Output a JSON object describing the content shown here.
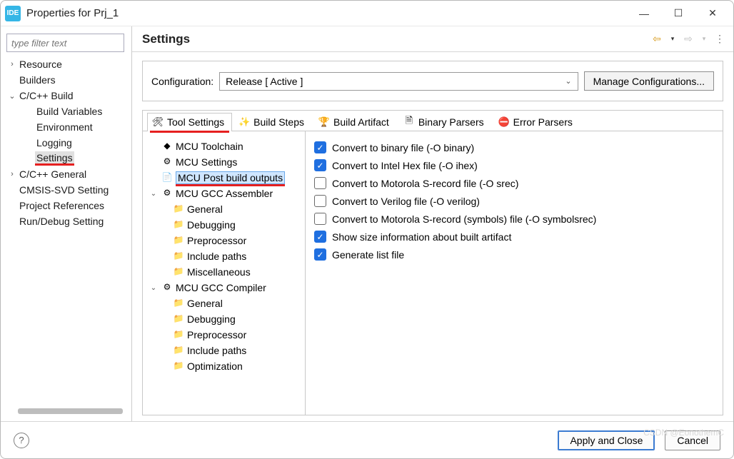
{
  "window": {
    "app_badge": "IDE",
    "title": "Properties for Prj_1"
  },
  "nav": {
    "filter_placeholder": "type filter text",
    "items": [
      {
        "label": "Resource",
        "expandable": true,
        "expanded": false
      },
      {
        "label": "Builders"
      },
      {
        "label": "C/C++ Build",
        "expandable": true,
        "expanded": true,
        "children": [
          {
            "label": "Build Variables"
          },
          {
            "label": "Environment"
          },
          {
            "label": "Logging"
          },
          {
            "label": "Settings",
            "highlighted": true
          }
        ]
      },
      {
        "label": "C/C++ General",
        "expandable": true,
        "expanded": false
      },
      {
        "label": "CMSIS-SVD Setting"
      },
      {
        "label": "Project References"
      },
      {
        "label": "Run/Debug Setting"
      }
    ]
  },
  "settings": {
    "title": "Settings",
    "config_label": "Configuration:",
    "config_value": "Release  [ Active ]",
    "manage_label": "Manage Configurations..."
  },
  "tabs": [
    {
      "id": "tool-settings",
      "label": "Tool Settings",
      "icon": "tool-icon",
      "active": true,
      "highlighted": true
    },
    {
      "id": "build-steps",
      "label": "Build Steps",
      "icon": "wand-icon"
    },
    {
      "id": "build-artifact",
      "label": "Build Artifact",
      "icon": "trophy-icon"
    },
    {
      "id": "binary-parsers",
      "label": "Binary Parsers",
      "icon": "binary-icon"
    },
    {
      "id": "error-parsers",
      "label": "Error Parsers",
      "icon": "error-icon"
    }
  ],
  "tool_tree": [
    {
      "label": "MCU Toolchain",
      "icon": "chip-icon"
    },
    {
      "label": "MCU Settings",
      "icon": "gear-icon"
    },
    {
      "label": "MCU Post build outputs",
      "icon": "page-icon",
      "selected": true,
      "highlighted": true
    },
    {
      "label": "MCU GCC Assembler",
      "icon": "gear-icon",
      "expandable": true,
      "expanded": true,
      "children": [
        {
          "label": "General",
          "icon": "folder-icon"
        },
        {
          "label": "Debugging",
          "icon": "folder-icon"
        },
        {
          "label": "Preprocessor",
          "icon": "folder-icon"
        },
        {
          "label": "Include paths",
          "icon": "folder-icon"
        },
        {
          "label": "Miscellaneous",
          "icon": "folder-icon"
        }
      ]
    },
    {
      "label": "MCU GCC Compiler",
      "icon": "gear-icon",
      "expandable": true,
      "expanded": true,
      "children": [
        {
          "label": "General",
          "icon": "folder-icon"
        },
        {
          "label": "Debugging",
          "icon": "folder-icon"
        },
        {
          "label": "Preprocessor",
          "icon": "folder-icon"
        },
        {
          "label": "Include paths",
          "icon": "folder-icon"
        },
        {
          "label": "Optimization",
          "icon": "folder-icon"
        }
      ]
    }
  ],
  "options": [
    {
      "label": "Convert to binary file (-O binary)",
      "checked": true
    },
    {
      "label": "Convert to Intel Hex file (-O ihex)",
      "checked": true
    },
    {
      "label": "Convert to Motorola S-record file (-O srec)",
      "checked": false
    },
    {
      "label": "Convert to Verilog file (-O verilog)",
      "checked": false
    },
    {
      "label": "Convert to Motorola S-record (symbols) file (-O symbolsrec)",
      "checked": false
    },
    {
      "label": "Show size information about built artifact",
      "checked": true
    },
    {
      "label": "Generate list file",
      "checked": true
    }
  ],
  "footer": {
    "apply_close": "Apply and Close",
    "cancel": "Cancel"
  },
  "watermark": "CSDN @EonothemC"
}
